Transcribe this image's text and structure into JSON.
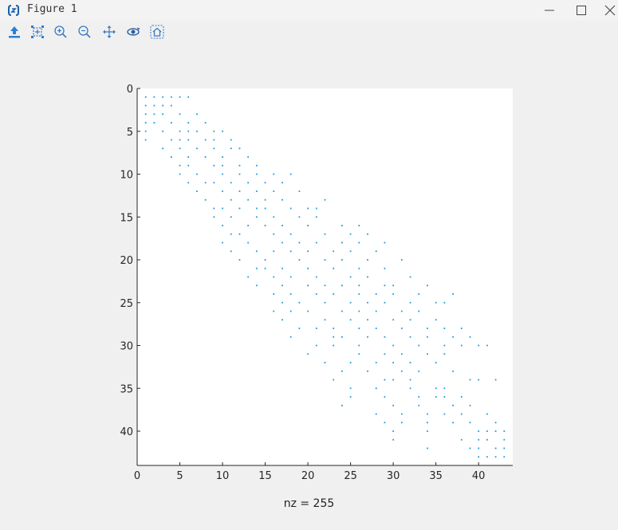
{
  "window": {
    "title": "Figure 1",
    "icons": [
      "figure-app-icon",
      "minimize-icon",
      "maximize-icon",
      "close-icon"
    ]
  },
  "toolbar": {
    "tools": [
      "save-icon",
      "data-cursor-icon",
      "zoom-in-icon",
      "zoom-out-icon",
      "pan-icon",
      "rotate-icon",
      "home-icon"
    ]
  },
  "colors": {
    "marker": "#1f9bde",
    "axes_bg": "#ffffff",
    "figure_bg": "#f0f0f0"
  },
  "chart_data": {
    "type": "scatter",
    "subtype": "sparsity-pattern",
    "xlabel": "nz = 255",
    "xlim": [
      0,
      44
    ],
    "ylim": [
      44,
      0
    ],
    "y_reversed": true,
    "xticks": [
      0,
      5,
      10,
      15,
      20,
      25,
      30,
      35,
      40
    ],
    "yticks": [
      0,
      5,
      10,
      15,
      20,
      25,
      30,
      35,
      40
    ],
    "grid": false,
    "points": [
      [
        1,
        1
      ],
      [
        2,
        1
      ],
      [
        3,
        1
      ],
      [
        4,
        1
      ],
      [
        5,
        1
      ],
      [
        6,
        1
      ],
      [
        1,
        2
      ],
      [
        2,
        2
      ],
      [
        3,
        2
      ],
      [
        4,
        2
      ],
      [
        1,
        3
      ],
      [
        2,
        3
      ],
      [
        3,
        3
      ],
      [
        5,
        3
      ],
      [
        7,
        3
      ],
      [
        1,
        4
      ],
      [
        2,
        4
      ],
      [
        4,
        4
      ],
      [
        6,
        4
      ],
      [
        8,
        4
      ],
      [
        1,
        5
      ],
      [
        3,
        5
      ],
      [
        5,
        5
      ],
      [
        6,
        5
      ],
      [
        7,
        5
      ],
      [
        9,
        5
      ],
      [
        10,
        5
      ],
      [
        1,
        6
      ],
      [
        4,
        6
      ],
      [
        5,
        6
      ],
      [
        6,
        6
      ],
      [
        8,
        6
      ],
      [
        9,
        6
      ],
      [
        11,
        6
      ],
      [
        3,
        7
      ],
      [
        5,
        7
      ],
      [
        7,
        7
      ],
      [
        9,
        7
      ],
      [
        11,
        7
      ],
      [
        12,
        7
      ],
      [
        4,
        8
      ],
      [
        6,
        8
      ],
      [
        8,
        8
      ],
      [
        10,
        8
      ],
      [
        13,
        8
      ],
      [
        5,
        9
      ],
      [
        6,
        9
      ],
      [
        9,
        9
      ],
      [
        10,
        9
      ],
      [
        12,
        9
      ],
      [
        14,
        9
      ],
      [
        5,
        10
      ],
      [
        7,
        10
      ],
      [
        10,
        10
      ],
      [
        12,
        10
      ],
      [
        14,
        10
      ],
      [
        16,
        10
      ],
      [
        18,
        10
      ],
      [
        6,
        11
      ],
      [
        8,
        11
      ],
      [
        9,
        11
      ],
      [
        11,
        11
      ],
      [
        13,
        11
      ],
      [
        15,
        11
      ],
      [
        17,
        11
      ],
      [
        7,
        12
      ],
      [
        10,
        12
      ],
      [
        12,
        12
      ],
      [
        14,
        12
      ],
      [
        16,
        12
      ],
      [
        19,
        12
      ],
      [
        8,
        13
      ],
      [
        11,
        13
      ],
      [
        13,
        13
      ],
      [
        15,
        13
      ],
      [
        17,
        13
      ],
      [
        22,
        13
      ],
      [
        9,
        14
      ],
      [
        10,
        14
      ],
      [
        12,
        14
      ],
      [
        14,
        14
      ],
      [
        15,
        14
      ],
      [
        18,
        14
      ],
      [
        20,
        14
      ],
      [
        21,
        14
      ],
      [
        9,
        15
      ],
      [
        11,
        15
      ],
      [
        14,
        15
      ],
      [
        16,
        15
      ],
      [
        19,
        15
      ],
      [
        21,
        15
      ],
      [
        10,
        16
      ],
      [
        13,
        16
      ],
      [
        15,
        16
      ],
      [
        17,
        16
      ],
      [
        20,
        16
      ],
      [
        24,
        16
      ],
      [
        26,
        16
      ],
      [
        11,
        17
      ],
      [
        12,
        17
      ],
      [
        16,
        17
      ],
      [
        18,
        17
      ],
      [
        22,
        17
      ],
      [
        25,
        17
      ],
      [
        27,
        17
      ],
      [
        10,
        18
      ],
      [
        13,
        18
      ],
      [
        17,
        18
      ],
      [
        19,
        18
      ],
      [
        21,
        18
      ],
      [
        24,
        18
      ],
      [
        26,
        18
      ],
      [
        29,
        18
      ],
      [
        11,
        19
      ],
      [
        14,
        19
      ],
      [
        16,
        19
      ],
      [
        18,
        19
      ],
      [
        20,
        19
      ],
      [
        23,
        19
      ],
      [
        25,
        19
      ],
      [
        28,
        19
      ],
      [
        12,
        20
      ],
      [
        15,
        20
      ],
      [
        19,
        20
      ],
      [
        22,
        20
      ],
      [
        24,
        20
      ],
      [
        27,
        20
      ],
      [
        31,
        20
      ],
      [
        14,
        21
      ],
      [
        15,
        21
      ],
      [
        17,
        21
      ],
      [
        20,
        21
      ],
      [
        23,
        21
      ],
      [
        26,
        21
      ],
      [
        29,
        21
      ],
      [
        13,
        22
      ],
      [
        16,
        22
      ],
      [
        18,
        22
      ],
      [
        21,
        22
      ],
      [
        25,
        22
      ],
      [
        27,
        22
      ],
      [
        32,
        22
      ],
      [
        14,
        23
      ],
      [
        17,
        23
      ],
      [
        20,
        23
      ],
      [
        22,
        23
      ],
      [
        24,
        23
      ],
      [
        26,
        23
      ],
      [
        29,
        23
      ],
      [
        30,
        23
      ],
      [
        34,
        23
      ],
      [
        16,
        24
      ],
      [
        18,
        24
      ],
      [
        21,
        24
      ],
      [
        23,
        24
      ],
      [
        26,
        24
      ],
      [
        28,
        24
      ],
      [
        30,
        24
      ],
      [
        33,
        24
      ],
      [
        37,
        24
      ],
      [
        17,
        25
      ],
      [
        19,
        25
      ],
      [
        22,
        25
      ],
      [
        25,
        25
      ],
      [
        27,
        25
      ],
      [
        29,
        25
      ],
      [
        32,
        25
      ],
      [
        35,
        25
      ],
      [
        36,
        25
      ],
      [
        16,
        26
      ],
      [
        18,
        26
      ],
      [
        20,
        26
      ],
      [
        24,
        26
      ],
      [
        26,
        26
      ],
      [
        28,
        26
      ],
      [
        31,
        26
      ],
      [
        33,
        26
      ],
      [
        17,
        27
      ],
      [
        22,
        27
      ],
      [
        25,
        27
      ],
      [
        27,
        27
      ],
      [
        30,
        27
      ],
      [
        32,
        27
      ],
      [
        35,
        27
      ],
      [
        19,
        28
      ],
      [
        21,
        28
      ],
      [
        23,
        28
      ],
      [
        26,
        28
      ],
      [
        28,
        28
      ],
      [
        31,
        28
      ],
      [
        34,
        28
      ],
      [
        36,
        28
      ],
      [
        38,
        28
      ],
      [
        18,
        29
      ],
      [
        23,
        29
      ],
      [
        24,
        29
      ],
      [
        27,
        29
      ],
      [
        29,
        29
      ],
      [
        32,
        29
      ],
      [
        34,
        29
      ],
      [
        37,
        29
      ],
      [
        39,
        29
      ],
      [
        21,
        30
      ],
      [
        23,
        30
      ],
      [
        26,
        30
      ],
      [
        30,
        30
      ],
      [
        33,
        30
      ],
      [
        36,
        30
      ],
      [
        38,
        30
      ],
      [
        40,
        30
      ],
      [
        41,
        30
      ],
      [
        20,
        31
      ],
      [
        26,
        31
      ],
      [
        29,
        31
      ],
      [
        31,
        31
      ],
      [
        34,
        31
      ],
      [
        36,
        31
      ],
      [
        22,
        32
      ],
      [
        25,
        32
      ],
      [
        28,
        32
      ],
      [
        30,
        32
      ],
      [
        32,
        32
      ],
      [
        35,
        32
      ],
      [
        24,
        33
      ],
      [
        27,
        33
      ],
      [
        31,
        33
      ],
      [
        33,
        33
      ],
      [
        37,
        33
      ],
      [
        23,
        34
      ],
      [
        29,
        34
      ],
      [
        30,
        34
      ],
      [
        32,
        34
      ],
      [
        39,
        34
      ],
      [
        40,
        34
      ],
      [
        42,
        34
      ],
      [
        25,
        35
      ],
      [
        28,
        35
      ],
      [
        32,
        35
      ],
      [
        35,
        35
      ],
      [
        36,
        35
      ],
      [
        25,
        36
      ],
      [
        29,
        36
      ],
      [
        33,
        36
      ],
      [
        35,
        36
      ],
      [
        36,
        36
      ],
      [
        38,
        36
      ],
      [
        24,
        37
      ],
      [
        30,
        37
      ],
      [
        33,
        37
      ],
      [
        37,
        37
      ],
      [
        39,
        37
      ],
      [
        28,
        38
      ],
      [
        31,
        38
      ],
      [
        34,
        38
      ],
      [
        36,
        38
      ],
      [
        38,
        38
      ],
      [
        41,
        38
      ],
      [
        29,
        39
      ],
      [
        31,
        39
      ],
      [
        34,
        39
      ],
      [
        37,
        39
      ],
      [
        39,
        39
      ],
      [
        42,
        39
      ],
      [
        30,
        40
      ],
      [
        34,
        40
      ],
      [
        40,
        40
      ],
      [
        41,
        40
      ],
      [
        42,
        40
      ],
      [
        43,
        40
      ],
      [
        30,
        41
      ],
      [
        38,
        41
      ],
      [
        40,
        41
      ],
      [
        41,
        41
      ],
      [
        43,
        41
      ],
      [
        34,
        42
      ],
      [
        39,
        42
      ],
      [
        40,
        42
      ],
      [
        42,
        42
      ],
      [
        43,
        42
      ],
      [
        40,
        43
      ],
      [
        41,
        43
      ],
      [
        42,
        43
      ],
      [
        43,
        43
      ]
    ]
  }
}
